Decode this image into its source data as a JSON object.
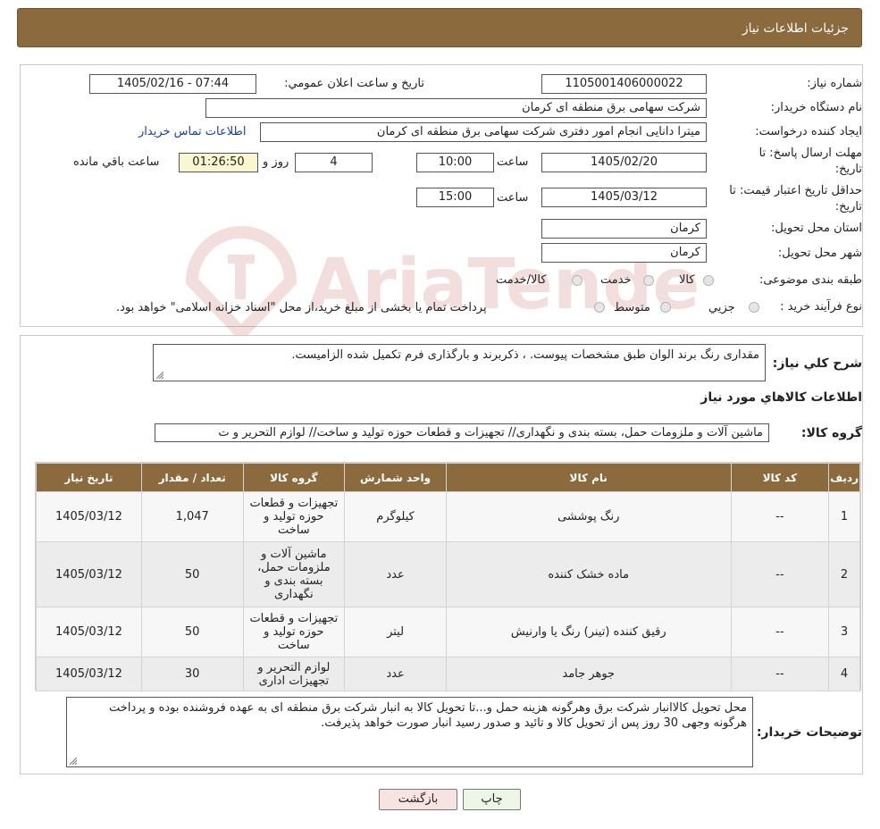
{
  "header": {
    "title": "جزئیات اطلاعات نیاز"
  },
  "form": {
    "need_number_label": "شماره نیاز:",
    "need_number": "1105001406000022",
    "announce_label": "تاریخ و ساعت اعلان عمومي:",
    "announce_value": "1405/02/16 - 07:44",
    "buyer_label": "نام دستگاه خریدار:",
    "buyer": "شرکت سهامی برق منطقه ای کرمان",
    "requester_label": "ایجاد کننده درخواست:",
    "requester": "میترا دانایی انجام امور دفتری شرکت سهامی برق منطقه ای کرمان",
    "contact_link": "اطلاعات تماس خریدار",
    "deadline_label_1": "مهلت ارسال پاسخ: تا",
    "deadline_label_2": "تاریخ:",
    "deadline_date": "1405/02/20",
    "time_label": "ساعت",
    "deadline_time": "10:00",
    "days_value": "4",
    "days_label": "روز و",
    "remaining_time": "01:26:50",
    "remaining_label": "ساعت باقي مانده",
    "validity_label_1": "حداقل تاریخ اعتبار قیمت: تا",
    "validity_label_2": "تاریخ:",
    "validity_date": "1405/03/12",
    "validity_time": "15:00",
    "province_label": "استان محل تحویل:",
    "province": "کرمان",
    "city_label": "شهر محل تحویل:",
    "city": "کرمان",
    "category_label": "طبقه بندی موضوعی:",
    "category_options": [
      "کالا",
      "خدمت",
      "کالا/خدمت"
    ],
    "process_label": "نوع فرآیند خرید :",
    "process_options": [
      "جزیي",
      "متوسط"
    ],
    "process_note": "پرداخت تمام یا بخشی از مبلغ خرید،از محل \"اسناد خزانه اسلامی\" خواهد بود."
  },
  "watermark_text": "AriaTender.neT",
  "summary": {
    "label": "شرح كلي نیاز:",
    "text": "مقداری رنگ برند الوان طبق مشخصات پیوست. ، ذکربرند و بارگذاری فرم تکمیل شده الزامیست."
  },
  "goods": {
    "section_title": "اطلاعات كالاهاي مورد نیاز",
    "group_label": "گروه كالا:",
    "group_value": "ماشین آلات و ملزومات حمل، بسته بندی و نگهداری// تجهیزات و قطعات حوزه تولید و ساخت// لوازم التحریر و ت",
    "headers": [
      "ردیف",
      "کد کالا",
      "نام کالا",
      "واحد شمارش",
      "گروه کالا",
      "تعداد / مقدار",
      "تاریخ نیاز"
    ],
    "rows": [
      [
        "1",
        "--",
        "رنگ پوششی",
        "کیلوگرم",
        "تجهیزات و قطعات حوزه تولید و ساخت",
        "1,047",
        "1405/03/12"
      ],
      [
        "2",
        "--",
        "ماده خشک کننده",
        "عدد",
        "ماشین آلات و ملزومات حمل، بسته بندی و نگهداری",
        "50",
        "1405/03/12"
      ],
      [
        "3",
        "--",
        "رقیق کننده (تینر) رنگ یا وارنیش",
        "لیتر",
        "تجهیزات و قطعات حوزه تولید و ساخت",
        "50",
        "1405/03/12"
      ],
      [
        "4",
        "--",
        "جوهر جامد",
        "عدد",
        "لوازم التحریر و تجهیزات اداری",
        "30",
        "1405/03/12"
      ]
    ]
  },
  "buyer_notes": {
    "label": "توضیحات خریدار:",
    "text": "محل تحویل کالاانبار شرکت برق وهرگونه هزینه حمل و...تا تحویل کالا به انبار شرکت برق منطقه ای به عهده فروشنده بوده و پرداخت هرگونه وجهی 30 روز پس از تحویل کالا و تائید و صدور رسید انبار صورت خواهد پذیرفت."
  },
  "buttons": {
    "print": "چاپ",
    "back": "بازگشت"
  }
}
